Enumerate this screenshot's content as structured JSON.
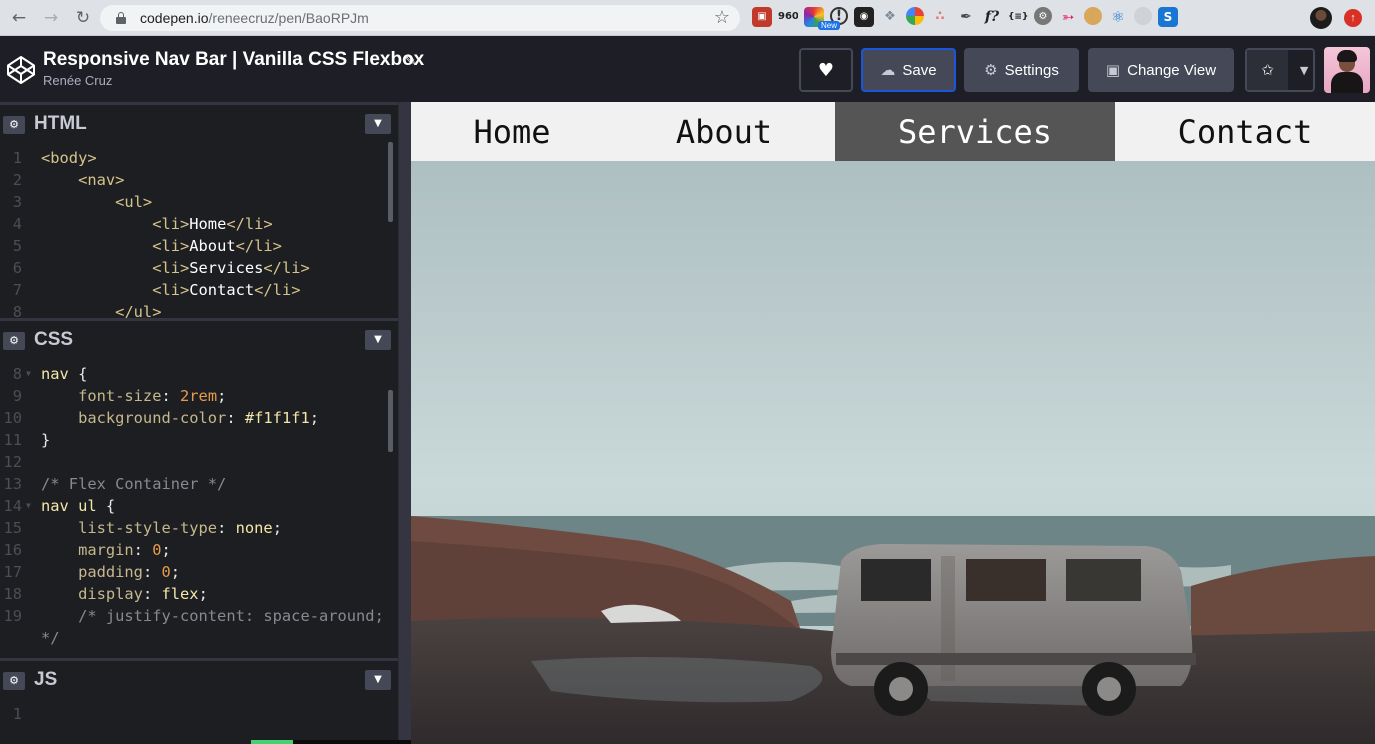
{
  "browser": {
    "url_host": "codepen.io",
    "url_path": "/reneecruz/pen/BaoRPJm",
    "extension_badge": "New",
    "extensions": [
      "960",
      "f?",
      "{≡}",
      "S"
    ]
  },
  "header": {
    "pen_title": "Responsive Nav Bar | Vanilla CSS Flexbox",
    "author": "Renée Cruz",
    "save_label": "Save",
    "settings_label": "Settings",
    "change_view_label": "Change View"
  },
  "panels": {
    "html_title": "HTML",
    "css_title": "CSS",
    "js_title": "JS"
  },
  "html_code": [
    {
      "n": "1",
      "parts": [
        [
          "t-tag",
          "<body>"
        ]
      ]
    },
    {
      "n": "2",
      "parts": [
        [
          "t-tag",
          "    <nav>"
        ]
      ]
    },
    {
      "n": "3",
      "parts": [
        [
          "t-tag",
          "        <ul>"
        ]
      ]
    },
    {
      "n": "4",
      "parts": [
        [
          "t-tag",
          "            <li>"
        ],
        [
          "t-txt",
          "Home"
        ],
        [
          "t-tag",
          "</li>"
        ]
      ]
    },
    {
      "n": "5",
      "parts": [
        [
          "t-tag",
          "            <li>"
        ],
        [
          "t-txt",
          "About"
        ],
        [
          "t-tag",
          "</li>"
        ]
      ]
    },
    {
      "n": "6",
      "parts": [
        [
          "t-tag",
          "            <li>"
        ],
        [
          "t-txt",
          "Services"
        ],
        [
          "t-tag",
          "</li>"
        ]
      ]
    },
    {
      "n": "7",
      "parts": [
        [
          "t-tag",
          "            <li>"
        ],
        [
          "t-txt",
          "Contact"
        ],
        [
          "t-tag",
          "</li>"
        ]
      ]
    },
    {
      "n": "8",
      "parts": [
        [
          "t-tag",
          "        </ul>"
        ]
      ]
    }
  ],
  "css_code": [
    {
      "n": "8",
      "parts": [
        [
          "t-sel",
          "nav"
        ],
        [
          "t-pun",
          " {"
        ]
      ]
    },
    {
      "n": "9",
      "parts": [
        [
          "t-prop",
          "    font-size"
        ],
        [
          "t-pun",
          ": "
        ],
        [
          "t-num",
          "2rem"
        ],
        [
          "t-pun",
          ";"
        ]
      ]
    },
    {
      "n": "10",
      "parts": [
        [
          "t-prop",
          "    background-color"
        ],
        [
          "t-pun",
          ": "
        ],
        [
          "t-hex",
          "#f1f1f1"
        ],
        [
          "t-pun",
          ";"
        ]
      ]
    },
    {
      "n": "11",
      "parts": [
        [
          "t-pun",
          "}"
        ]
      ]
    },
    {
      "n": "12",
      "parts": []
    },
    {
      "n": "13",
      "parts": [
        [
          "t-com",
          "/* Flex Container */"
        ]
      ]
    },
    {
      "n": "14",
      "parts": [
        [
          "t-sel",
          "nav ul"
        ],
        [
          "t-pun",
          " {"
        ]
      ]
    },
    {
      "n": "15",
      "parts": [
        [
          "t-prop",
          "    list-style-type"
        ],
        [
          "t-pun",
          ": "
        ],
        [
          "t-kw",
          "none"
        ],
        [
          "t-pun",
          ";"
        ]
      ]
    },
    {
      "n": "16",
      "parts": [
        [
          "t-prop",
          "    margin"
        ],
        [
          "t-pun",
          ": "
        ],
        [
          "t-num",
          "0"
        ],
        [
          "t-pun",
          ";"
        ]
      ]
    },
    {
      "n": "17",
      "parts": [
        [
          "t-prop",
          "    padding"
        ],
        [
          "t-pun",
          ": "
        ],
        [
          "t-num",
          "0"
        ],
        [
          "t-pun",
          ";"
        ]
      ]
    },
    {
      "n": "18",
      "parts": [
        [
          "t-prop",
          "    display"
        ],
        [
          "t-pun",
          ": "
        ],
        [
          "t-kw",
          "flex"
        ],
        [
          "t-pun",
          ";"
        ]
      ]
    },
    {
      "n": "19",
      "parts": [
        [
          "t-com",
          "    /* justify-content: space-around;"
        ]
      ]
    },
    {
      "n": "",
      "parts": [
        [
          "t-com",
          "*/"
        ]
      ]
    }
  ],
  "js_code": [
    {
      "n": "1",
      "parts": []
    }
  ],
  "preview": {
    "nav_items": [
      "Home",
      "About",
      "Services",
      "Contact"
    ],
    "active_item": "Services"
  },
  "colors": {
    "codepen_bg": "#1e1f26",
    "button_bg": "#444857",
    "save_border": "#1a56db",
    "nav_bg": "#f1f1f1",
    "nav_active": "#555555"
  }
}
